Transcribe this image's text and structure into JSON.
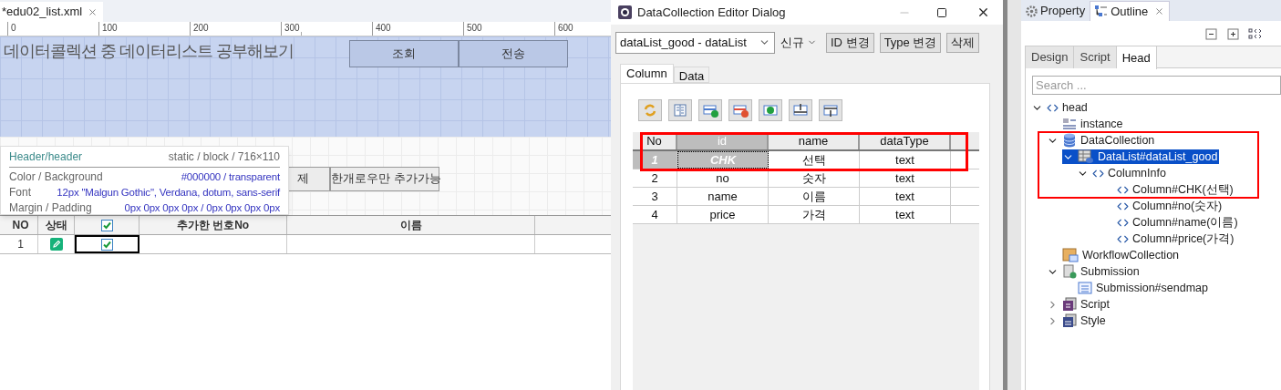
{
  "editor": {
    "file_tab": "*edu02_list.xml",
    "ruler": [
      "0",
      "100",
      "200",
      "300",
      "400",
      "500",
      "600"
    ],
    "header": {
      "title": "데이터콜렉션 중 데이터리스트 공부해보기",
      "buttons": [
        "조회",
        "전송"
      ]
    },
    "button_row": [
      "제",
      "한개로우만 추가가능"
    ],
    "tooltip": {
      "title": "Header/header",
      "info": "static / block / 716×110",
      "rows": [
        {
          "label": "Color / Background",
          "value": "#000000 / transparent"
        },
        {
          "label": "Font",
          "value": "12px \"Malgun Gothic\", Verdana, dotum, sans-serif"
        },
        {
          "label": "Margin / Padding",
          "value": "0px 0px 0px 0px / 0px 0px 0px 0px"
        }
      ]
    },
    "grid": {
      "columns": [
        {
          "kind": "text",
          "label": "NO"
        },
        {
          "kind": "text",
          "label": "상태"
        },
        {
          "kind": "checkbox",
          "checked": true
        },
        {
          "kind": "text",
          "label": "추가한 번호No"
        },
        {
          "kind": "text",
          "label": "이름"
        }
      ],
      "rows": [
        {
          "no": "1",
          "checked": true
        }
      ]
    }
  },
  "dialog": {
    "title": "DataCollection Editor Dialog",
    "select": "dataList_good - dataList",
    "new_label": "신규",
    "buttons": [
      "ID 변경",
      "Type 변경",
      "삭제"
    ],
    "tabs": [
      {
        "label": "Column",
        "selected": true
      },
      {
        "label": "Data",
        "selected": false
      }
    ],
    "table": {
      "columns": [
        "No",
        "id",
        "name",
        "dataType"
      ],
      "rows": [
        {
          "no": "1",
          "id": "CHK",
          "name": "선택",
          "dataType": "text",
          "selected": true
        },
        {
          "no": "2",
          "id": "no",
          "name": "숫자",
          "dataType": "text",
          "selected": false
        },
        {
          "no": "3",
          "id": "name",
          "name": "이름",
          "dataType": "text",
          "selected": false
        },
        {
          "no": "4",
          "id": "price",
          "name": "가격",
          "dataType": "text",
          "selected": false
        }
      ]
    }
  },
  "panel": {
    "tabs": [
      {
        "label": "Property",
        "selected": false
      },
      {
        "label": "Outline",
        "selected": true
      }
    ],
    "inner_tabs": [
      {
        "label": "Design",
        "selected": false
      },
      {
        "label": "Script",
        "selected": false
      },
      {
        "label": "Head",
        "selected": true
      }
    ],
    "search": {
      "placeholder": "Search ..."
    },
    "tree": [
      {
        "label": "head",
        "kind": "tag",
        "expanded": true,
        "selected": false,
        "children": [
          {
            "label": "instance",
            "kind": "instance",
            "selected": false
          },
          {
            "label": "DataCollection",
            "kind": "database",
            "expanded": true,
            "selected": false,
            "children": [
              {
                "label": "DataList#dataList_good",
                "kind": "datalist",
                "expanded": true,
                "selected": true,
                "children": [
                  {
                    "label": "ColumnInfo",
                    "kind": "tag",
                    "expanded": true,
                    "selected": false,
                    "children": [
                      {
                        "label": "Column#CHK(선택)",
                        "kind": "tag",
                        "selected": false
                      },
                      {
                        "label": "Column#no(숫자)",
                        "kind": "tag",
                        "selected": false
                      },
                      {
                        "label": "Column#name(이름)",
                        "kind": "tag",
                        "selected": false
                      },
                      {
                        "label": "Column#price(가격)",
                        "kind": "tag",
                        "selected": false
                      }
                    ]
                  }
                ]
              }
            ]
          },
          {
            "label": "WorkflowCollection",
            "kind": "workflow",
            "selected": false
          },
          {
            "label": "Submission",
            "kind": "submission",
            "expanded": true,
            "selected": false,
            "children": [
              {
                "label": "Submission#sendmap",
                "kind": "form",
                "selected": false
              }
            ]
          },
          {
            "label": "Script",
            "kind": "script",
            "expanded": false,
            "selected": false
          },
          {
            "label": "Style",
            "kind": "style",
            "expanded": false,
            "selected": false
          }
        ]
      }
    ]
  }
}
